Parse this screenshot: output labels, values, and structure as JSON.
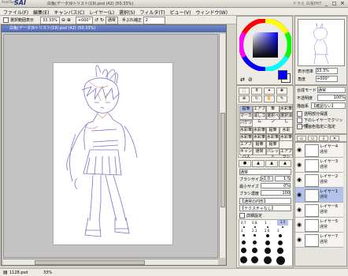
{
  "app": {
    "name": "SAI",
    "logo_sub": "PaintTool",
    "window_title": "白兔(データ)9トリスト(19).psd (42) (50.33%)",
    "window_buttons": [
      "_",
      "□",
      "×"
    ],
    "right_title": "ドラえ 白兎PHT",
    "status_left": "1128.psd",
    "status_zoom": "33%"
  },
  "menu": [
    "ファイル(F)",
    "編集(E)",
    "キャンバス(C)",
    "レイヤー(L)",
    "選択(S)",
    "フィルタ(T)",
    "ビュー(V)",
    "ウィンドウ(W)"
  ],
  "toolbar": {
    "selection_check": "選択範囲表示",
    "zoom": "33.33%",
    "angle": "+000°",
    "normal_btn": "通常",
    "stabilizer_label": "手ぶれ補正",
    "stabilizer_value": "2"
  },
  "document": {
    "title": "白兔(データ)9トリスト(19).psd (42) (50.33%)"
  },
  "navigator": {
    "zoom_label": "表示倍率",
    "zoom_value": "33.3%",
    "angle_label": "角度",
    "angle_value": "+000°"
  },
  "layer_props": {
    "mode_label": "合成モード",
    "mode_value": "通常",
    "opacity_label": "不透明度",
    "opacity_value": "100%",
    "protect_label": "描画系",
    "protect_value": "【確認ない】",
    "check1": "透明部分保護",
    "check2": "下のレイヤーでクリッピング",
    "check3": "描画色指定に指定"
  },
  "tools": {
    "row1": [
      "鉛筆",
      "エアブラシ",
      "筆",
      "水彩筆"
    ],
    "row2": [
      "マーカー",
      "消しゴム",
      "選択ペン",
      "選択消し"
    ],
    "row3": [
      "バケツ",
      "",
      "",
      ""
    ],
    "row4": [
      "水彩筆",
      "水彩筆",
      "鉛筆",
      "水彩"
    ],
    "row5": [
      "水彩筆",
      "水彩筆",
      "水彩筆",
      "水彩筆"
    ],
    "row6": [
      "エアブラシ",
      "鉛筆",
      "鉛筆",
      ""
    ],
    "row7": [
      "キャンバス",
      "通常",
      "パレット",
      "エアブラシ"
    ]
  },
  "brush": {
    "mode_value": "通常",
    "size_label": "ブラシサイズ",
    "size_mult": "x1.0",
    "size_value": "1.5",
    "min_label": "最小サイズ",
    "min_value": "0%",
    "density_label": "ブラシ濃度",
    "density_value": "100",
    "shape_value": "【通常の円形】",
    "texture_value": "【テクスチャなし】",
    "detail_check": "詳細設定",
    "size_grid": [
      "0.7",
      "0.8",
      "1",
      "1.5",
      "2",
      "2.3",
      "2.6",
      "3",
      "3.5",
      "4",
      "5",
      "6",
      "7",
      "8",
      "9",
      "10"
    ]
  },
  "layers": [
    {
      "name": "レイヤー4",
      "mode": "通常",
      "opacity": "100%",
      "selected": false
    },
    {
      "name": "レイヤー3",
      "mode": "通常",
      "opacity": "100%",
      "selected": false
    },
    {
      "name": "レイヤー2",
      "mode": "通常",
      "opacity": "100%",
      "selected": false
    },
    {
      "name": "レイヤー1",
      "mode": "通常",
      "opacity": "100%",
      "selected": true
    },
    {
      "name": "レイヤー6",
      "mode": "通常",
      "opacity": "100%",
      "selected": false
    },
    {
      "name": "レイヤー5",
      "mode": "通常",
      "opacity": "100%",
      "selected": false
    },
    {
      "name": "レイヤー7",
      "mode": "通常",
      "opacity": "100%",
      "selected": false
    }
  ],
  "colors": {
    "foreground": "#0000ff",
    "background": "#ffffff",
    "selection": "#b3c2ea",
    "sketch_line": "#7b74c9",
    "sketch_red": "#d88080"
  }
}
